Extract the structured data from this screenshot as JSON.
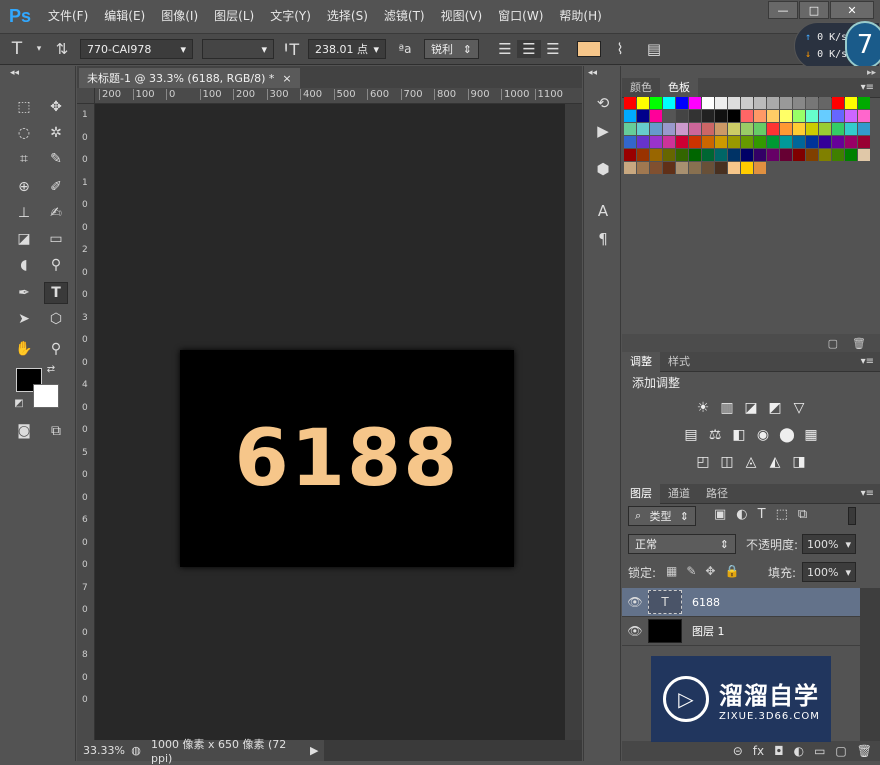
{
  "app": {
    "logo": "Ps"
  },
  "menu": [
    "文件(F)",
    "编辑(E)",
    "图像(I)",
    "图层(L)",
    "文字(Y)",
    "选择(S)",
    "滤镜(T)",
    "视图(V)",
    "窗口(W)",
    "帮助(H)"
  ],
  "window_controls": {
    "minimize": "—",
    "maximize": "□",
    "close": "✕"
  },
  "options": {
    "tool_icon": "T",
    "font_family": "770-CAI978",
    "font_style": "",
    "font_size": "238.01 点",
    "aa_icon": "ªa",
    "antialias": "锐利",
    "text_color": "#f6c68a"
  },
  "net_speed": {
    "up": "0 K/s",
    "down": "0 K/s",
    "badge": "7"
  },
  "document": {
    "tab_title": "未标题-1 @ 33.3% (6188, RGB/8) *",
    "tab_close": "×",
    "ruler_h": [
      "200",
      "100",
      "0",
      "100",
      "200",
      "300",
      "400",
      "500",
      "600",
      "700",
      "800",
      "900",
      "1000",
      "1100"
    ],
    "ruler_v": [
      "1",
      "0",
      "0",
      "1",
      "0",
      "0",
      "2",
      "0",
      "0",
      "3",
      "0",
      "0",
      "4",
      "0",
      "0",
      "5",
      "0",
      "0",
      "6",
      "0",
      "0",
      "7",
      "0",
      "0",
      "8",
      "0",
      "0"
    ],
    "canvas_text": "6188",
    "canvas_text_color": "#f6c68a",
    "zoom": "33.33%",
    "doc_info": "1000 像素 x 650 像素 (72 ppi)"
  },
  "swatches_panel": {
    "tabs": [
      "颜色",
      "色板"
    ],
    "colors": [
      "#ff0000",
      "#ffff00",
      "#00ff00",
      "#00ffff",
      "#0000ff",
      "#ff00ff",
      "#ffffff",
      "#eeeeee",
      "#dddddd",
      "#cccccc",
      "#bbbbbb",
      "#aaaaaa",
      "#999999",
      "#888888",
      "#777777",
      "#666666",
      "#ff0000",
      "#ffff00",
      "#00aa00",
      "#00aaff",
      "#00008b",
      "#ff0099",
      "#555555",
      "#444444",
      "#333333",
      "#222222",
      "#111111",
      "#000000",
      "#ff6666",
      "#ff9966",
      "#ffcc66",
      "#ffff66",
      "#99ff66",
      "#66ffcc",
      "#66ccff",
      "#6666ff",
      "#cc66ff",
      "#ff66cc",
      "#66cc99",
      "#66cccc",
      "#6699cc",
      "#9999cc",
      "#cc99cc",
      "#cc6699",
      "#cc6666",
      "#cc9966",
      "#cccc66",
      "#99cc66",
      "#66cc66",
      "#ff3333",
      "#ff9933",
      "#ffcc33",
      "#cccc00",
      "#99cc33",
      "#33cc66",
      "#33cccc",
      "#3399cc",
      "#3366cc",
      "#6633cc",
      "#9933cc",
      "#cc3399",
      "#cc0033",
      "#cc3300",
      "#cc6600",
      "#cc9900",
      "#999900",
      "#669900",
      "#339900",
      "#009933",
      "#009999",
      "#006699",
      "#003399",
      "#330099",
      "#660099",
      "#990066",
      "#990033",
      "#990000",
      "#993300",
      "#996600",
      "#666600",
      "#336600",
      "#006600",
      "#006633",
      "#006666",
      "#003366",
      "#000066",
      "#330066",
      "#660066",
      "#660033",
      "#800000",
      "#804000",
      "#808000",
      "#408000",
      "#008000",
      "#e0c8a8",
      "#c8a880",
      "#a07850",
      "#805030",
      "#603018",
      "#a89070",
      "#887050",
      "#685038",
      "#483020",
      "#f6c68a",
      "#ffcc00",
      "#e09040"
    ]
  },
  "adjustments_panel": {
    "tabs": [
      "调整",
      "样式"
    ],
    "title": "添加调整",
    "row1": [
      "☀",
      "▥",
      "◪",
      "◩",
      "▽"
    ],
    "row2": [
      "▤",
      "⚖",
      "◧",
      "◉",
      "⬤",
      "▦"
    ],
    "row3": [
      "◰",
      "◫",
      "◬",
      "◭",
      "◨"
    ]
  },
  "layers_panel": {
    "tabs": [
      "图层",
      "通道",
      "路径"
    ],
    "filter_kind": "类型",
    "blend_mode": "正常",
    "opacity_label": "不透明度:",
    "opacity": "100%",
    "lock_label": "锁定:",
    "fill_label": "填充:",
    "fill": "100%",
    "layers": [
      {
        "name": "6188",
        "kind": "text",
        "thumb": "T",
        "selected": true
      },
      {
        "name": "图层 1",
        "kind": "pixel",
        "thumb": "",
        "selected": false
      }
    ],
    "bottom_icons": [
      "⊝",
      "fx",
      "◘",
      "◐",
      "▭",
      "▢",
      "🗑"
    ]
  },
  "watermark": {
    "title": "溜溜自学",
    "url": "ZIXUE.3D66.COM"
  }
}
